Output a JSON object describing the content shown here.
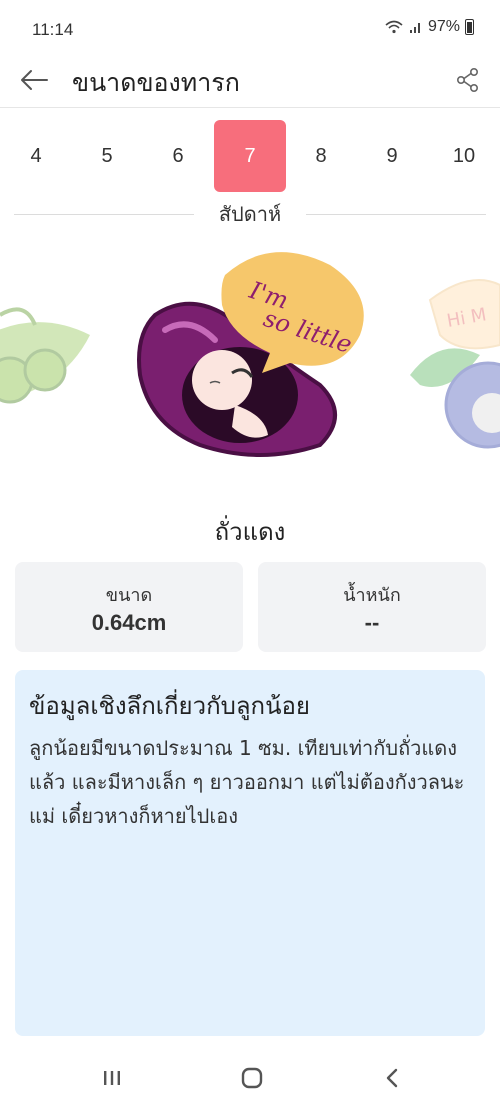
{
  "status": {
    "time": "11:14",
    "battery": "97%"
  },
  "app_bar": {
    "title": "ขนาดของทารก"
  },
  "weeks": {
    "items": [
      "4",
      "5",
      "6",
      "7",
      "8",
      "9",
      "10"
    ],
    "selected": "7",
    "label": "สัปดาห์"
  },
  "illustration": {
    "speech_text_1": "I'm",
    "speech_text_2": "so little",
    "side_speech": "Hi M"
  },
  "fruit": {
    "name": "ถั่วแดง"
  },
  "stats": {
    "size_label": "ขนาด",
    "size_value": "0.64cm",
    "weight_label": "น้ำหนัก",
    "weight_value": "--"
  },
  "info": {
    "title": "ข้อมูลเชิงลึกเกี่ยวกับลูกน้อย",
    "body": "ลูกน้อยมีขนาดประมาณ 1 ซม. เทียบเท่ากับถั่วแดงแล้ว และมีหางเล็ก ๆ ยาวออกมา แต่ไม่ต้องกังวลนะแม่ เดี๋ยวหางก็หายไปเอง"
  },
  "colors": {
    "accent": "#f76e7c",
    "info_bg": "#e3f1fd",
    "card_bg": "#f2f3f5",
    "bean": "#7a1f6f"
  }
}
